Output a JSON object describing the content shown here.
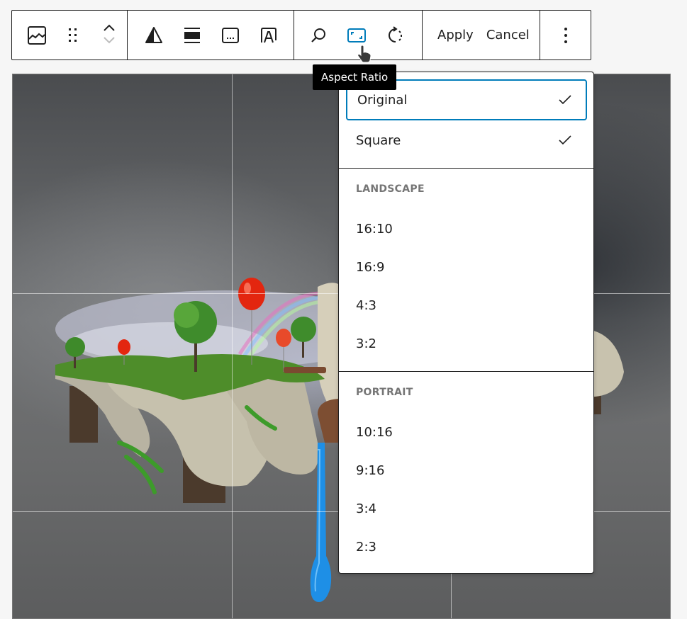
{
  "toolbar": {
    "groups": [
      {
        "items": [
          {
            "icon": "image-icon",
            "label": "Image"
          },
          {
            "icon": "drag-handle-icon",
            "label": "Drag"
          },
          {
            "icon": "move-up-icon",
            "label": "Move up"
          },
          {
            "icon": "move-down-icon",
            "label": "Move down"
          }
        ]
      },
      {
        "items": [
          {
            "icon": "duotone-icon",
            "label": "Apply duotone filter"
          },
          {
            "icon": "align-wide-icon",
            "label": "Align"
          },
          {
            "icon": "caption-icon",
            "label": "Caption"
          },
          {
            "icon": "text-over-image-icon",
            "label": "Add text over image"
          }
        ]
      },
      {
        "items": [
          {
            "icon": "zoom-icon",
            "label": "Zoom"
          },
          {
            "icon": "aspect-ratio-icon",
            "label": "Aspect Ratio",
            "active": true
          },
          {
            "icon": "rotate-icon",
            "label": "Rotate"
          }
        ]
      }
    ],
    "apply_label": "Apply",
    "cancel_label": "Cancel",
    "more_label": "Options"
  },
  "tooltip": {
    "text": "Aspect Ratio"
  },
  "accent_color": "#007cba",
  "aspect_menu": {
    "top_items": [
      {
        "label": "Original",
        "checked": true,
        "focused": true
      },
      {
        "label": "Square",
        "checked": true
      }
    ],
    "sections": [
      {
        "heading": "LANDSCAPE",
        "items": [
          "16:10",
          "16:9",
          "4:3",
          "3:2"
        ]
      },
      {
        "heading": "PORTRAIT",
        "items": [
          "10:16",
          "9:16",
          "3:4",
          "2:3"
        ]
      }
    ]
  },
  "image": {
    "alt": "Floating island with trees, balloons, rainbow and a dripping faucet on a concrete background",
    "crop_grid": "3x3"
  }
}
